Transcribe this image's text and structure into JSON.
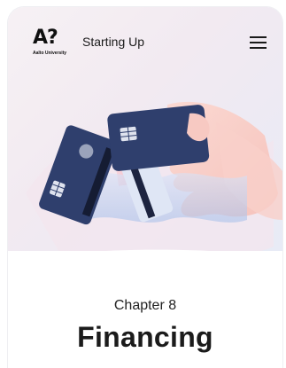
{
  "header": {
    "logo_mark": "A?",
    "logo_subtitle": "Aalto University",
    "title": "Starting Up",
    "menu_icon": "hamburger-menu-icon"
  },
  "hero": {
    "illustration_icon": "credit-cards-in-hand-illustration"
  },
  "chapter": {
    "label": "Chapter 8",
    "title": "Financing"
  },
  "colors": {
    "card": "#2f3f6d",
    "chip": "#dfe3ee",
    "hand": "#f7c9c2",
    "accent_pink": "#f3b7c2",
    "accent_blue": "#b9cdf0",
    "text": "#1b1b1b"
  }
}
